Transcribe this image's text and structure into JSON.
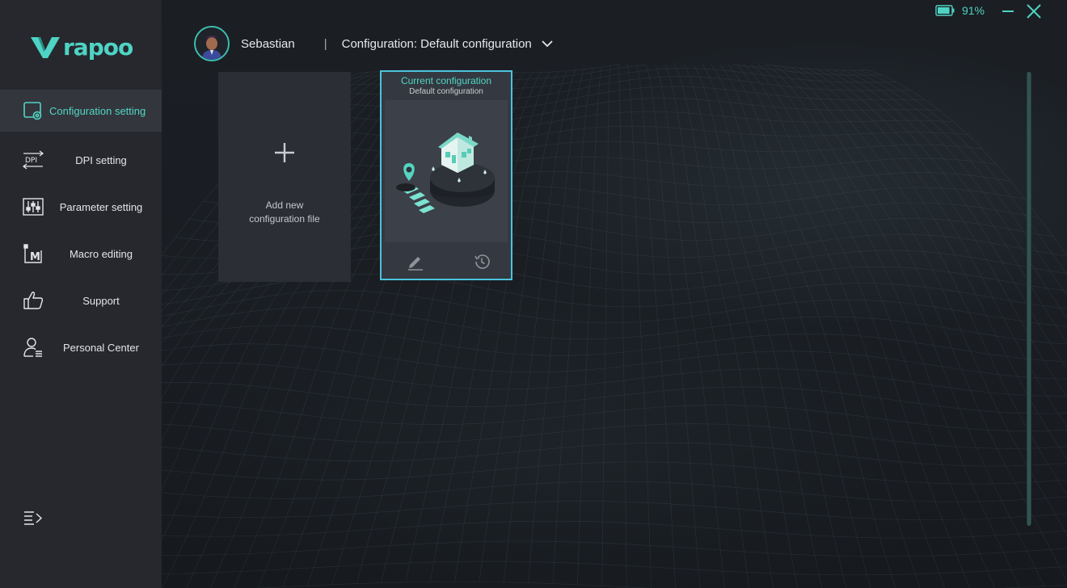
{
  "brand": {
    "logo_text": "rapoo",
    "accent": "#4fd3c4"
  },
  "sidebar": {
    "items": [
      {
        "label": "Configuration setting",
        "icon": "config-gear-icon",
        "active": true
      },
      {
        "label": "DPI setting",
        "icon": "dpi-icon",
        "active": false
      },
      {
        "label": "Parameter setting",
        "icon": "sliders-icon",
        "active": false
      },
      {
        "label": "Macro editing",
        "icon": "macro-icon",
        "active": false
      },
      {
        "label": "Support",
        "icon": "thumbs-up-icon",
        "active": false
      },
      {
        "label": "Personal Center",
        "icon": "user-list-icon",
        "active": false
      }
    ],
    "collapse_icon": "menu-collapse-icon"
  },
  "titlebar": {
    "battery_text": "91%",
    "battery_level": 0.91,
    "minimize_icon": "minimize-icon",
    "close_icon": "close-icon"
  },
  "header": {
    "username": "Sebastian",
    "separator": "|",
    "configuration_label": "Configuration: Default configuration"
  },
  "cards": {
    "add": {
      "label_line1": "Add new",
      "label_line2": "configuration file"
    },
    "current": {
      "title": "Current configuration",
      "subtitle": "Default configuration",
      "edit_icon": "pencil-icon",
      "history_icon": "history-icon"
    }
  }
}
